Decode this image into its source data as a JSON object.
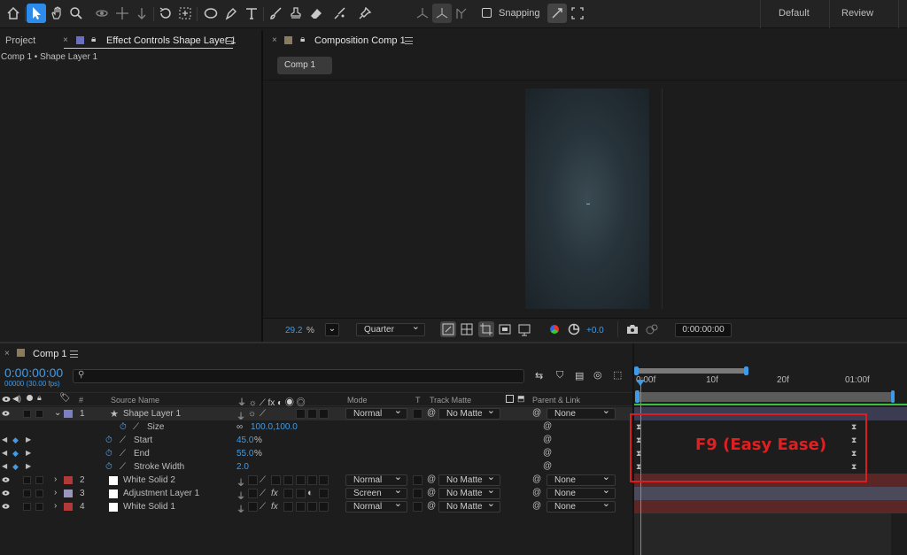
{
  "toolbar": {
    "snapping_label": "Snapping",
    "workspaces": [
      "Default",
      "Review"
    ]
  },
  "left_panel": {
    "tab_project": "Project",
    "tab_effect_controls": "Effect Controls Shape Layer 1",
    "breadcrumb": "Comp 1 • Shape Layer 1"
  },
  "viewer": {
    "tab_label": "Composition Comp 1",
    "comp_button": "Comp 1",
    "zoom_value": "29.2",
    "zoom_unit": "%",
    "resolution": "Quarter",
    "exposure": "+0.0",
    "timecode": "0:00:00:00"
  },
  "timeline": {
    "tab_label": "Comp 1",
    "current_time": "0:00:00:00",
    "frame_info": "00000 (30.00 fps)",
    "search_placeholder": "",
    "columns": {
      "number": "#",
      "source_name": "Source Name",
      "mode": "Mode",
      "t": "T",
      "track_matte": "Track Matte",
      "parent": "Parent & Link"
    },
    "ruler": [
      "0:00f",
      "10f",
      "20f",
      "01:00f"
    ],
    "layers": [
      {
        "num": "1",
        "name": "Shape Layer 1",
        "mode": "Normal",
        "matte": "No Matte",
        "parent": "None",
        "color": "#7b7fc4"
      },
      {
        "num": "2",
        "name": "White Solid 2",
        "mode": "Normal",
        "matte": "No Matte",
        "parent": "None",
        "color": "#b03a3a"
      },
      {
        "num": "3",
        "name": "Adjustment Layer 1",
        "mode": "Screen",
        "matte": "No Matte",
        "parent": "None",
        "color": "#9a96c0"
      },
      {
        "num": "4",
        "name": "White Solid 1",
        "mode": "Normal",
        "matte": "No Matte",
        "parent": "None",
        "color": "#b03a3a"
      }
    ],
    "properties": [
      {
        "name": "Size",
        "value": "100.0,100.0",
        "unit": ""
      },
      {
        "name": "Start",
        "value": "45.0",
        "unit": "%"
      },
      {
        "name": "End",
        "value": "55.0",
        "unit": "%"
      },
      {
        "name": "Stroke Width",
        "value": "2.0",
        "unit": ""
      }
    ],
    "annotation": "F9 (Easy Ease)"
  },
  "colors": {
    "accent": "#2d8ceb",
    "annotation_red": "#e02020",
    "layer_bar_shape": "#3d3d5c",
    "layer_bar_solid": "#5a2626"
  }
}
